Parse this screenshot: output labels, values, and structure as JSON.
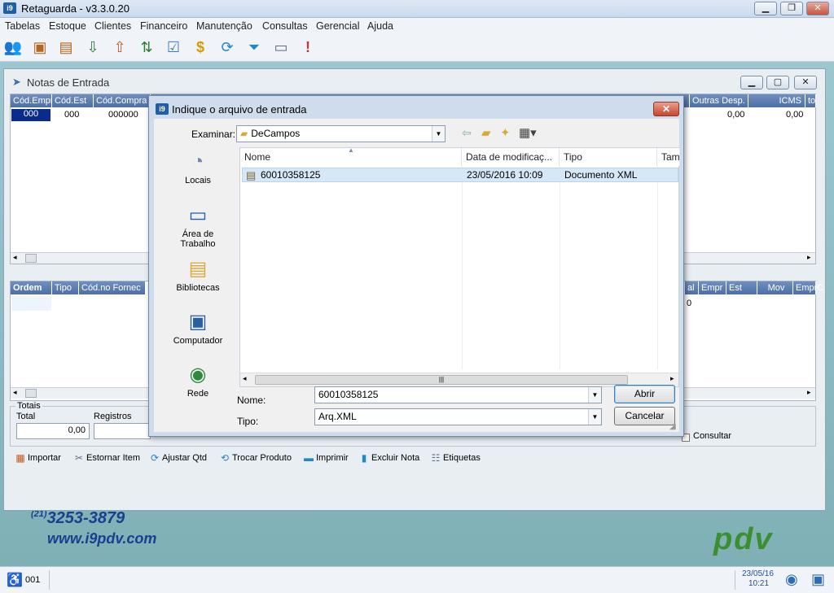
{
  "app": {
    "title": "Retaguarda - v3.3.0.20",
    "menu": [
      "Tabelas",
      "Estoque",
      "Clientes",
      "Financeiro",
      "Manutenção",
      "Consultas",
      "Gerencial",
      "Ajuda"
    ],
    "toolbar_icons": [
      "users-icon",
      "box-icon",
      "box-open-icon",
      "box-down-icon",
      "box-up-icon",
      "box-transfer-icon",
      "checkbox-icon",
      "dollar-icon",
      "refresh-icon",
      "filter-icon",
      "window-icon",
      "warning-icon"
    ]
  },
  "notas": {
    "title": "Notas de Entrada",
    "top_headers": [
      "Cód.Empr",
      "Cód.Est",
      "Cód.Compra",
      "Outras Desp.",
      "ICMS",
      "to"
    ],
    "top_row": {
      "cod_empr": "000",
      "cod_est": "000",
      "cod_compra": "000000",
      "outras_desp": "0,00",
      "icms": "0,00"
    },
    "bottom_headers_left": [
      "Ordem",
      "Tipo",
      "Cód.no Fornec"
    ],
    "bottom_headers_right": [
      "al",
      "Empr",
      "Est",
      "Mov",
      "EmprC"
    ],
    "bottom_value": "0",
    "totais": {
      "group_label": "Totais",
      "total_label": "Total",
      "total_value": "0,00",
      "registros_label": "Registros"
    },
    "consultar_label": "Consultar",
    "actions": [
      {
        "label": "Importar",
        "icon": "xml-icon"
      },
      {
        "label": "Estornar Item",
        "icon": "tools-icon"
      },
      {
        "label": "Ajustar Qtd",
        "icon": "refresh-icon"
      },
      {
        "label": "Trocar Produto",
        "icon": "swap-icon"
      },
      {
        "label": "Imprimir",
        "icon": "printer-icon"
      },
      {
        "label": "Excluir Nota",
        "icon": "trash-icon"
      },
      {
        "label": "Etiquetas",
        "icon": "labels-icon"
      }
    ]
  },
  "branding": {
    "phone_prefix": "(21)",
    "phone": "3253-3879",
    "site": "www.i9pdv.com",
    "logo": "pdv"
  },
  "statusbar": {
    "code": "001",
    "date": "23/05/16",
    "time": "10:21"
  },
  "dialog": {
    "title": "Indique o arquivo de entrada",
    "examinar_label": "Examinar:",
    "folder": "DeCampos",
    "places": [
      "Locais",
      "Área de Trabalho",
      "Bibliotecas",
      "Computador",
      "Rede"
    ],
    "columns": [
      "Nome",
      "Data de modificaç...",
      "Tipo",
      "Tam"
    ],
    "files": [
      {
        "name": "60010358125",
        "modified": "23/05/2016 10:09",
        "type": "Documento XML"
      }
    ],
    "nome_label": "Nome:",
    "nome_value": "60010358125",
    "tipo_label": "Tipo:",
    "tipo_value": "Arq.XML",
    "open_button": "Abrir",
    "cancel_button": "Cancelar"
  }
}
